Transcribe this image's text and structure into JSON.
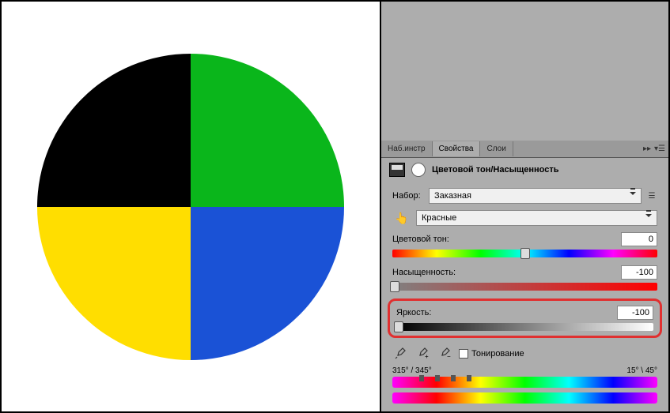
{
  "tabs": {
    "tools": "Наб.инстр",
    "properties": "Свойства",
    "layers": "Слои"
  },
  "panel": {
    "title": "Цветовой тон/Насыщенность",
    "preset_label": "Набор:",
    "preset_value": "Заказная",
    "channel_value": "Красные",
    "hue_label": "Цветовой тон:",
    "hue_value": "0",
    "saturation_label": "Насыщенность:",
    "saturation_value": "-100",
    "lightness_label": "Яркость:",
    "lightness_value": "-100",
    "colorize_label": "Тонирование",
    "range_left": "315° / 345°",
    "range_right": "15° \\ 45°"
  }
}
